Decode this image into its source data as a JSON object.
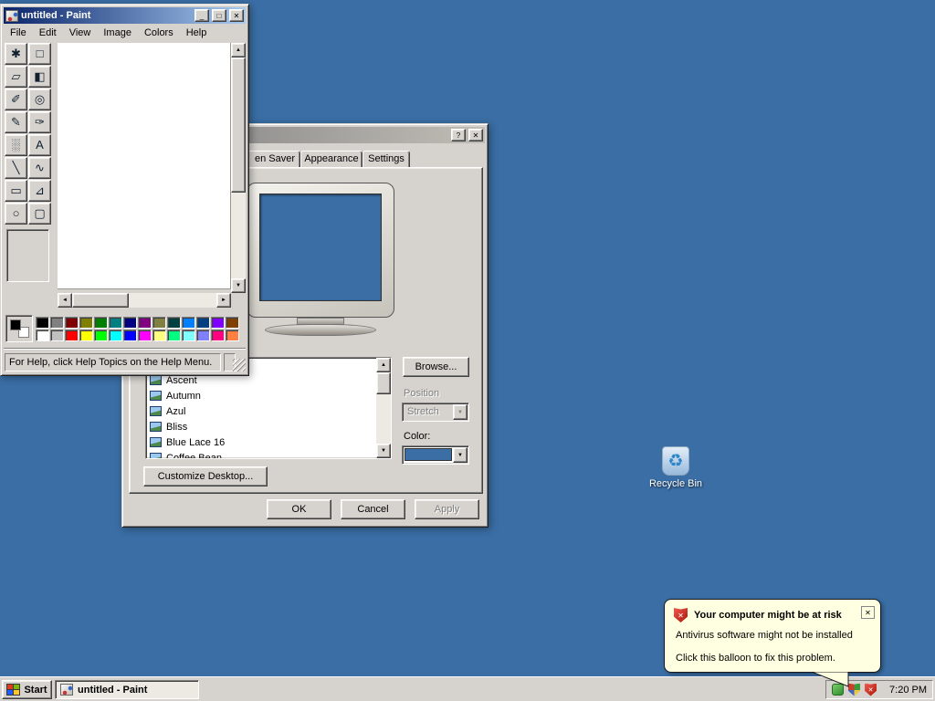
{
  "desktop": {
    "background_color": "#3A6EA5",
    "recycle_bin_label": "Recycle Bin"
  },
  "glyphs": {
    "scroll_up": "▲",
    "scroll_down": "▼",
    "scroll_left": "◄",
    "scroll_right": "►",
    "dropdown": "▼",
    "recycle": "♻",
    "shield_cross": "✕"
  },
  "paint": {
    "title": "untitled - Paint",
    "window_buttons": {
      "minimize": "_",
      "maximize": "□",
      "close": "✕"
    },
    "menus": [
      "File",
      "Edit",
      "View",
      "Image",
      "Colors",
      "Help"
    ],
    "tools": [
      {
        "name": "free-form-select",
        "glyph": "✱"
      },
      {
        "name": "select",
        "glyph": "□"
      },
      {
        "name": "eraser",
        "glyph": "▱"
      },
      {
        "name": "fill-with-color",
        "glyph": "◧"
      },
      {
        "name": "pick-color",
        "glyph": "✐"
      },
      {
        "name": "magnifier",
        "glyph": "◎"
      },
      {
        "name": "pencil",
        "glyph": "✎"
      },
      {
        "name": "brush",
        "glyph": "✑"
      },
      {
        "name": "airbrush",
        "glyph": "░"
      },
      {
        "name": "text",
        "glyph": "A"
      },
      {
        "name": "line",
        "glyph": "╲"
      },
      {
        "name": "curve",
        "glyph": "∿"
      },
      {
        "name": "rectangle",
        "glyph": "▭"
      },
      {
        "name": "polygon",
        "glyph": "⊿"
      },
      {
        "name": "ellipse",
        "glyph": "○"
      },
      {
        "name": "rounded-rectangle",
        "glyph": "▢"
      }
    ],
    "palette": [
      "#000000",
      "#808080",
      "#800000",
      "#808000",
      "#008000",
      "#008080",
      "#000080",
      "#800080",
      "#808040",
      "#004040",
      "#0080FF",
      "#004080",
      "#8000FF",
      "#804000",
      "#FFFFFF",
      "#C0C0C0",
      "#FF0000",
      "#FFFF00",
      "#00FF00",
      "#00FFFF",
      "#0000FF",
      "#FF00FF",
      "#FFFF80",
      "#00FF80",
      "#80FFFF",
      "#8080FF",
      "#FF0080",
      "#FF8040"
    ],
    "status_text": "For Help, click Help Topics on the Help Menu."
  },
  "display_properties": {
    "titlebar_buttons": {
      "help": "?",
      "close": "✕"
    },
    "tabs": [
      "en Saver",
      "Appearance",
      "Settings"
    ],
    "background_items": [
      "Ascent",
      "Autumn",
      "Azul",
      "Bliss",
      "Blue Lace 16",
      "Coffee Bean"
    ],
    "browse_button": "Browse...",
    "position_label": "Position",
    "position_value": "Stretch",
    "color_label": "Color:",
    "color_swatch": "#3A6EA5",
    "customize_button": "Customize Desktop...",
    "ok_button": "OK",
    "cancel_button": "Cancel",
    "apply_button": "Apply"
  },
  "balloon": {
    "title": "Your computer might be at risk",
    "line1": "Antivirus software might not be installed",
    "line2": "Click this balloon to fix this problem.",
    "close": "✕"
  },
  "taskbar": {
    "start_label": "Start",
    "task_button": "untitled - Paint",
    "clock": "7:20 PM"
  }
}
